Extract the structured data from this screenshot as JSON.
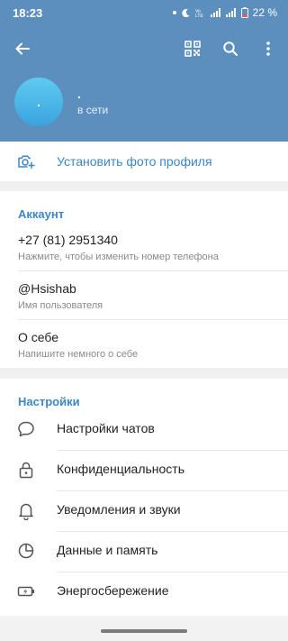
{
  "status_bar": {
    "time": "18:23",
    "battery": "22 %"
  },
  "header": {
    "avatar_initial": ".",
    "name": ".",
    "status": "в сети"
  },
  "set_photo": {
    "label": "Установить фото профиля"
  },
  "account": {
    "title": "Аккаунт",
    "phone": {
      "value": "+27 (81) 2951340",
      "hint": "Нажмите, чтобы изменить номер телефона"
    },
    "username": {
      "value": "@Hsishab",
      "hint": "Имя пользователя"
    },
    "bio": {
      "value": "О себе",
      "hint": "Напишите немного о себе"
    }
  },
  "settings": {
    "title": "Настройки",
    "items": [
      {
        "label": "Настройки чатов",
        "icon": "chat-bubble-icon"
      },
      {
        "label": "Конфиденциальность",
        "icon": "lock-icon"
      },
      {
        "label": "Уведомления и звуки",
        "icon": "bell-icon"
      },
      {
        "label": "Данные и память",
        "icon": "pie-chart-icon"
      },
      {
        "label": "Энергосбережение",
        "icon": "battery-bolt-icon"
      }
    ]
  },
  "colors": {
    "header": "#5c8fbd",
    "accent": "#3a87c9",
    "avatar": "#4db6ec"
  }
}
